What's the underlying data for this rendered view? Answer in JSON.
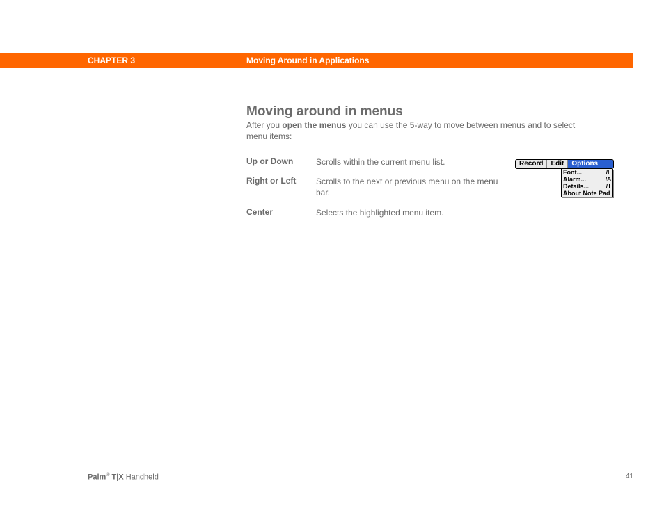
{
  "header": {
    "chapter": "CHAPTER 3",
    "title": "Moving Around in Applications"
  },
  "section": {
    "heading": "Moving around in menus",
    "intro_before": "After you ",
    "intro_link": "open the menus",
    "intro_after": " you can use the 5-way to move between menus and to select menu items:"
  },
  "definitions": [
    {
      "term": "Up or Down",
      "desc": "Scrolls within the current menu list."
    },
    {
      "term": "Right or Left",
      "desc": "Scrolls to the next or previous menu on the menu bar."
    },
    {
      "term": "Center",
      "desc": "Selects the highlighted menu item."
    }
  ],
  "figure": {
    "tabs": [
      "Record",
      "Edit",
      "Options"
    ],
    "items": [
      {
        "label": "Font...",
        "hint": "/F"
      },
      {
        "label": "Alarm...",
        "hint": "/A"
      },
      {
        "label": "Details...",
        "hint": "/T"
      },
      {
        "label": "About Note Pad",
        "hint": ""
      }
    ]
  },
  "footer": {
    "brand": "Palm",
    "model": "T|X",
    "suffix": "Handheld",
    "page": "41"
  }
}
